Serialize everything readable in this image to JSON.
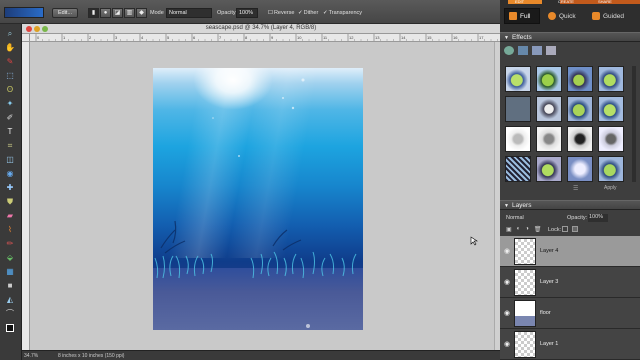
{
  "options_bar": {
    "edit_label": "Edit...",
    "mode_label": "Mode",
    "mode_value": "Normal",
    "opacity_label": "Opacity:",
    "opacity_value": "100%",
    "reverse_label": "Reverse",
    "dither_label": "Dither",
    "transparency_label": "Transparency"
  },
  "mode_bar": {
    "tabs": [
      "EDIT",
      "CREATE",
      "SHARE"
    ],
    "full_label": "Full",
    "quick_label": "Quick",
    "guided_label": "Guided"
  },
  "document": {
    "title": "seascape.psd @ 34.7% (Layer 4, RGB/8)",
    "ruler_labels": [
      "0",
      "1",
      "2",
      "3",
      "4",
      "5",
      "6",
      "7",
      "8",
      "9",
      "10",
      "11",
      "12",
      "13",
      "14",
      "15",
      "16",
      "17"
    ]
  },
  "status": {
    "zoom": "34.7%",
    "size": "8 inches x 10 inches (150 ppi)"
  },
  "effects_panel": {
    "title": "Effects",
    "apply_label": "Apply"
  },
  "layers_panel": {
    "title": "Layers",
    "blend_mode": "Normal",
    "opacity_label": "Opacity:",
    "opacity_value": "100%",
    "lock_label": "Lock:",
    "layers": [
      {
        "name": "Layer 4",
        "selected": true
      },
      {
        "name": "Layer 3",
        "selected": false
      },
      {
        "name": "floor",
        "selected": false
      },
      {
        "name": "Layer 1",
        "selected": false
      }
    ]
  },
  "colors": {
    "accent_orange": "#e8892a",
    "panel_bg": "#3e3e3e",
    "canvas_bg": "#c9c9c9"
  }
}
